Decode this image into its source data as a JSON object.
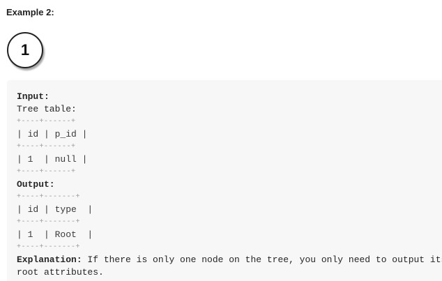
{
  "example_title": "Example 2:",
  "tree": {
    "node_value": "1"
  },
  "code": {
    "input_label": "Input:",
    "table_name": "Tree table:",
    "input_table": {
      "border_top": "+----+------+",
      "header_row": "| id | p_id |",
      "border_mid": "+----+------+",
      "row_1": "| 1  | null |",
      "border_bottom": "+----+------+"
    },
    "output_label": "Output:",
    "output_table": {
      "border_top": "+----+-------+",
      "header_row": "| id | type  |",
      "border_mid": "+----+-------+",
      "row_1": "| 1  | Root  |",
      "border_bottom": "+----+-------+"
    },
    "explanation_label": "Explanation:",
    "explanation_text": " If there is only one node on the tree, you only need to output its",
    "explanation_text_2": "root attributes."
  }
}
